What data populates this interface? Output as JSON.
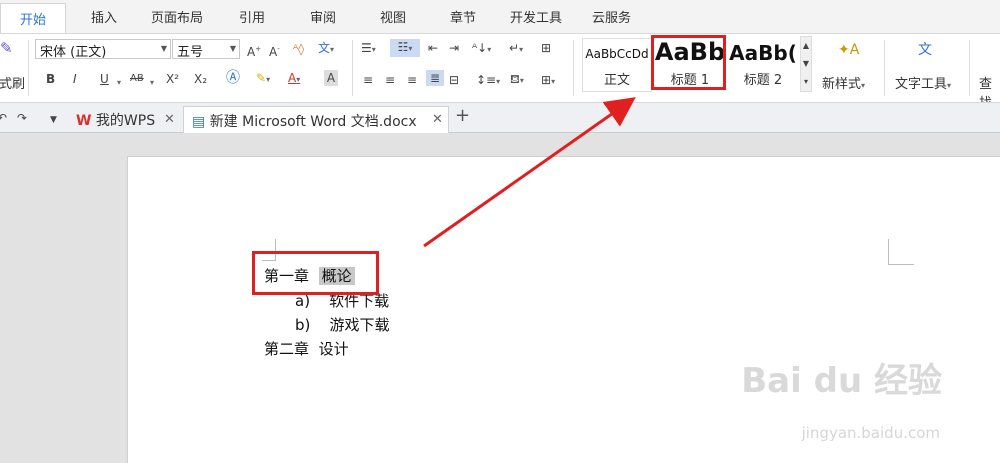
{
  "menu": {
    "tabs": [
      "开始",
      "插入",
      "页面布局",
      "引用",
      "审阅",
      "视图",
      "章节",
      "开发工具",
      "云服务"
    ]
  },
  "ribbon": {
    "format_painter_label": "式刷",
    "font_name": "宋体 (正文)",
    "font_size": "五号",
    "bold": "B",
    "italic": "I",
    "underline": "U",
    "superscript": "X²",
    "subscript": "X₂",
    "styles": [
      {
        "sample": "AaBbCcDd",
        "name": "正文"
      },
      {
        "sample": "AaBb",
        "name": "标题 1"
      },
      {
        "sample": "AaBb(",
        "name": "标题 2"
      }
    ],
    "new_style_label": "新样式",
    "text_tools_label": "文字工具",
    "find_label": "查找"
  },
  "tabs": {
    "home_tab": "我的WPS",
    "doc_tab": "新建 Microsoft Word 文档.docx",
    "add": "+"
  },
  "document": {
    "lines": [
      {
        "prefix": "第一章",
        "text": "概论"
      },
      {
        "prefix": "a)",
        "text": "软件下载"
      },
      {
        "prefix": "b)",
        "text": "游戏下载"
      },
      {
        "prefix": "第二章",
        "text": "设计"
      }
    ]
  },
  "watermark": {
    "main": "Bai du 经验",
    "sub": "jingyan.baidu.com"
  },
  "colors": {
    "accent": "#2b74d4",
    "annotation_red": "#e02020",
    "wps_red": "#d9302c"
  }
}
